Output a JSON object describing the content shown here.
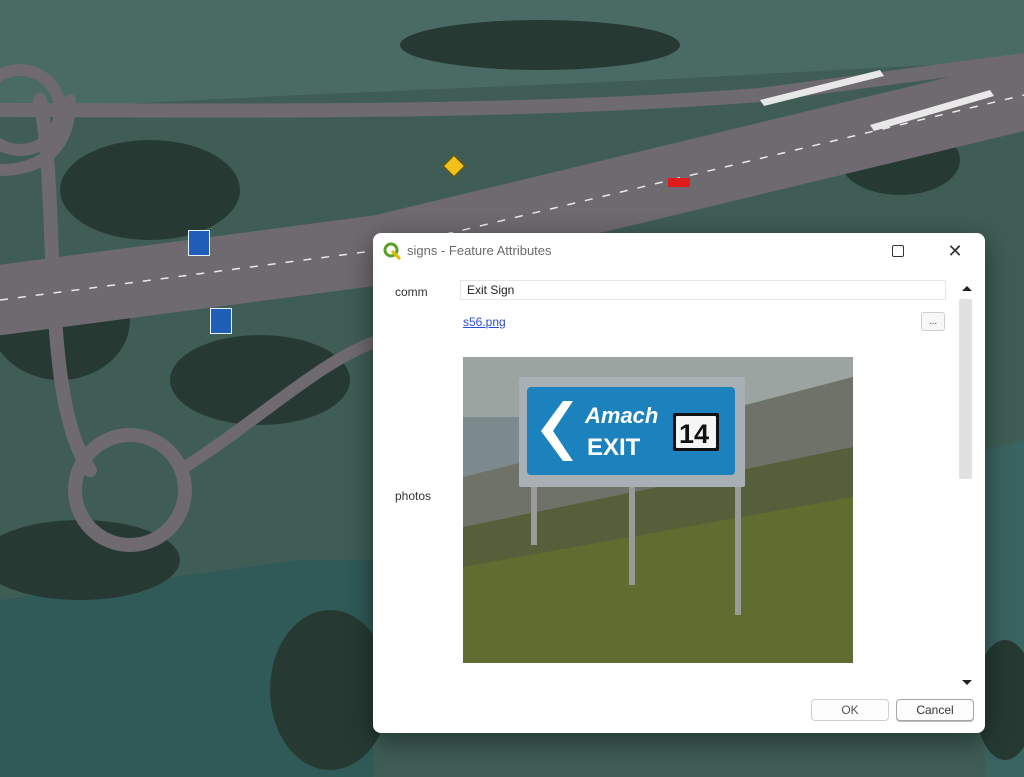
{
  "map": {
    "markers": [
      {
        "id": "sign-blue-1",
        "icon": "blue-exit-sign-marker"
      },
      {
        "id": "sign-blue-2",
        "icon": "blue-exit-sign-marker"
      },
      {
        "id": "sign-warning",
        "icon": "yellow-warning-sign-marker"
      },
      {
        "id": "sign-red",
        "icon": "red-sign-marker"
      }
    ],
    "colors": {
      "field": "#3c5a52",
      "road": "#6d6a6e",
      "trees": "#22332e"
    }
  },
  "dialog": {
    "title": "signs - Feature Attributes",
    "maximize_icon": "maximize-icon",
    "close_icon": "close-icon",
    "close_symbol": "✕",
    "fields": {
      "comm_label": "comm",
      "comm_value": "Exit Sign",
      "file_link": "s56.png",
      "browse_label": "...",
      "photos_label": "photos"
    },
    "photo": {
      "sign_line1": "Amach",
      "sign_line2": "EXIT",
      "sign_number": "14"
    },
    "buttons": {
      "ok": "OK",
      "cancel": "Cancel"
    }
  }
}
